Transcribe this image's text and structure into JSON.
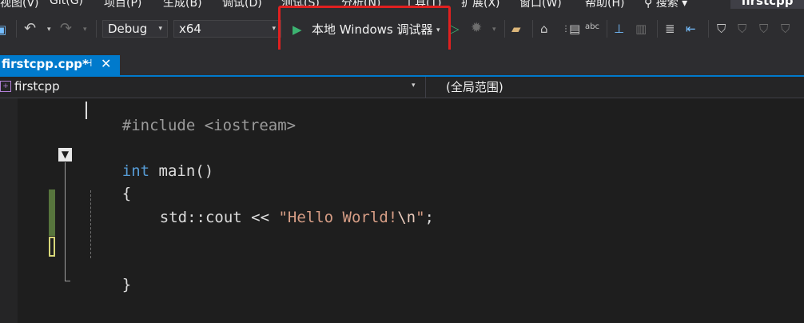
{
  "menu": [
    "视图(V)",
    "Git(G)",
    "项目(P)",
    "生成(B)",
    "调试(D)",
    "测试(S)",
    "分析(N)",
    "工具(T)",
    "扩展(X)",
    "窗口(W)",
    "帮助(H)"
  ],
  "search_label": "搜索",
  "project_title": "firstcpp",
  "toolbar": {
    "config": "Debug",
    "platform": "x64",
    "run_label": "本地 Windows 调试器"
  },
  "tab": {
    "label": "firstcpp.cpp*",
    "pin": "⊣",
    "close": "✕"
  },
  "navbar": {
    "file": "firstcpp",
    "scope": "(全局范围)"
  },
  "code": {
    "include": "#include <iostream>",
    "int_kw": "int",
    "main_sig": " main()",
    "open_brace": "{",
    "stmt_prefix": "std::cout << ",
    "str_start": "\"Hello World!",
    "esc": "\\n",
    "str_end": "\"",
    "semi": ";",
    "close_brace": "}"
  },
  "colors": {
    "accent": "#007acc",
    "highlight_box": "#e02020",
    "keyword": "#569cd6",
    "string": "#d69d85"
  }
}
